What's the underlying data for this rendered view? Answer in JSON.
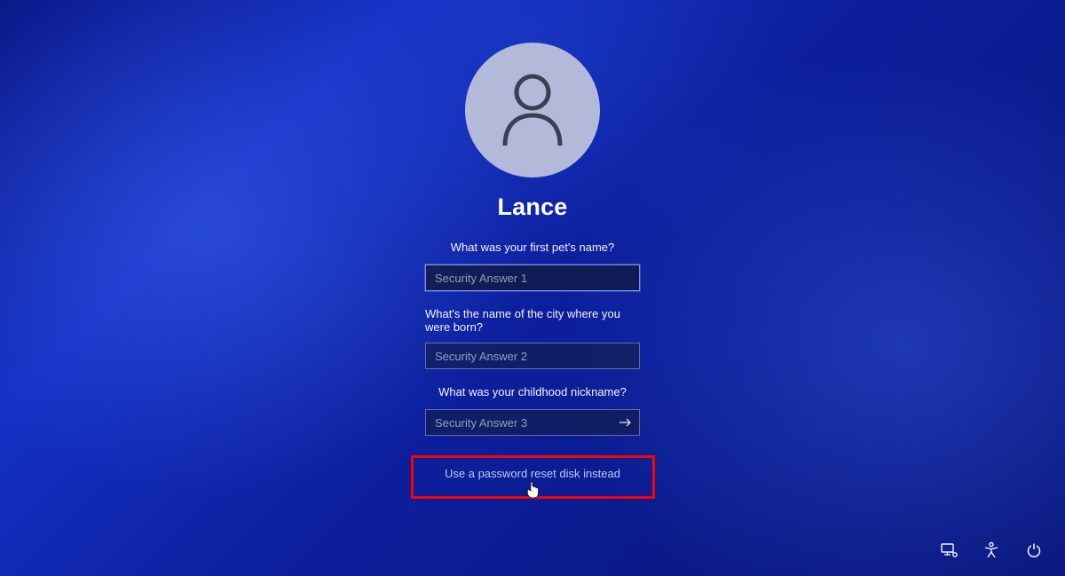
{
  "user": {
    "name": "Lance"
  },
  "questions": {
    "q1": "What was your first pet's name?",
    "q2": "What's the name of the city where you were born?",
    "q3": "What was your childhood nickname?"
  },
  "placeholders": {
    "a1": "Security Answer 1",
    "a2": "Security Answer 2",
    "a3": "Security Answer 3"
  },
  "reset_link": "Use a password reset disk instead"
}
